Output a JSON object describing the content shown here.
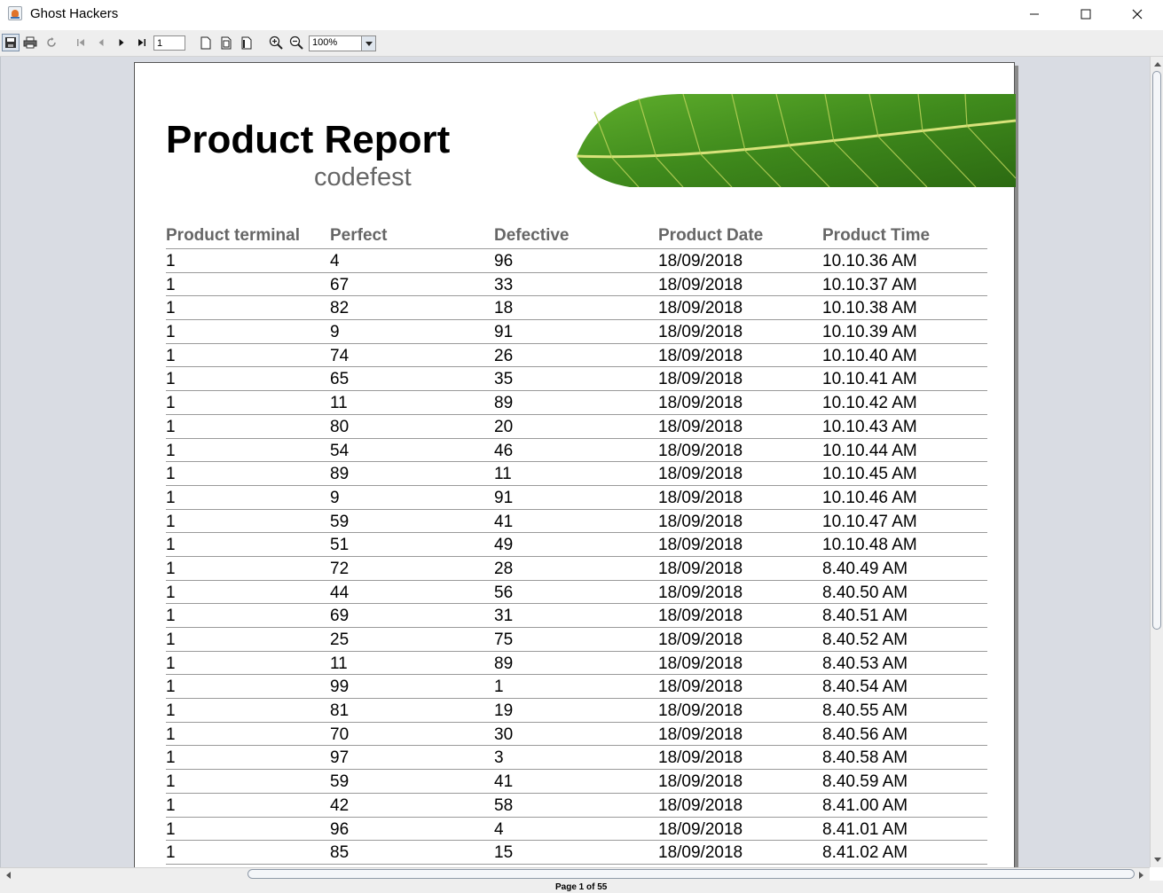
{
  "window": {
    "title": "Ghost Hackers",
    "controls": [
      "minimize-icon",
      "maximize-icon",
      "close-icon"
    ]
  },
  "toolbar": {
    "buttons": [
      "save-icon",
      "print-icon",
      "reload-icon",
      "first-page-icon",
      "previous-page-icon",
      "next-page-icon",
      "last-page-icon",
      "actual-size-icon",
      "fit-page-icon",
      "fit-width-icon",
      "zoom-in-icon",
      "zoom-out-icon"
    ],
    "page_number": "1",
    "zoom": "100%",
    "zoom_options": [
      "100%"
    ]
  },
  "report": {
    "title": "Product Report",
    "subtitle": "codefest",
    "columns": [
      "Product terminal",
      "Perfect",
      "Defective",
      "Product Date",
      "Product Time"
    ],
    "rows": [
      [
        "1",
        "4",
        "96",
        "18/09/2018",
        "10.10.36 AM"
      ],
      [
        "1",
        "67",
        "33",
        "18/09/2018",
        "10.10.37 AM"
      ],
      [
        "1",
        "82",
        "18",
        "18/09/2018",
        "10.10.38 AM"
      ],
      [
        "1",
        "9",
        "91",
        "18/09/2018",
        "10.10.39 AM"
      ],
      [
        "1",
        "74",
        "26",
        "18/09/2018",
        "10.10.40 AM"
      ],
      [
        "1",
        "65",
        "35",
        "18/09/2018",
        "10.10.41 AM"
      ],
      [
        "1",
        "11",
        "89",
        "18/09/2018",
        "10.10.42 AM"
      ],
      [
        "1",
        "80",
        "20",
        "18/09/2018",
        "10.10.43 AM"
      ],
      [
        "1",
        "54",
        "46",
        "18/09/2018",
        "10.10.44 AM"
      ],
      [
        "1",
        "89",
        "11",
        "18/09/2018",
        "10.10.45 AM"
      ],
      [
        "1",
        "9",
        "91",
        "18/09/2018",
        "10.10.46 AM"
      ],
      [
        "1",
        "59",
        "41",
        "18/09/2018",
        "10.10.47 AM"
      ],
      [
        "1",
        "51",
        "49",
        "18/09/2018",
        "10.10.48 AM"
      ],
      [
        "1",
        "72",
        "28",
        "18/09/2018",
        "8.40.49 AM"
      ],
      [
        "1",
        "44",
        "56",
        "18/09/2018",
        "8.40.50 AM"
      ],
      [
        "1",
        "69",
        "31",
        "18/09/2018",
        "8.40.51 AM"
      ],
      [
        "1",
        "25",
        "75",
        "18/09/2018",
        "8.40.52 AM"
      ],
      [
        "1",
        "11",
        "89",
        "18/09/2018",
        "8.40.53 AM"
      ],
      [
        "1",
        "99",
        "1",
        "18/09/2018",
        "8.40.54 AM"
      ],
      [
        "1",
        "81",
        "19",
        "18/09/2018",
        "8.40.55 AM"
      ],
      [
        "1",
        "70",
        "30",
        "18/09/2018",
        "8.40.56 AM"
      ],
      [
        "1",
        "97",
        "3",
        "18/09/2018",
        "8.40.58 AM"
      ],
      [
        "1",
        "59",
        "41",
        "18/09/2018",
        "8.40.59 AM"
      ],
      [
        "1",
        "42",
        "58",
        "18/09/2018",
        "8.41.00 AM"
      ],
      [
        "1",
        "96",
        "4",
        "18/09/2018",
        "8.41.01 AM"
      ],
      [
        "1",
        "85",
        "15",
        "18/09/2018",
        "8.41.02 AM"
      ]
    ]
  },
  "status": {
    "text": "Page 1 of 55"
  },
  "colors": {
    "header_text": "#666666",
    "viewport_bg": "#d9dce3",
    "leaf_green": "#3f8a1c"
  }
}
